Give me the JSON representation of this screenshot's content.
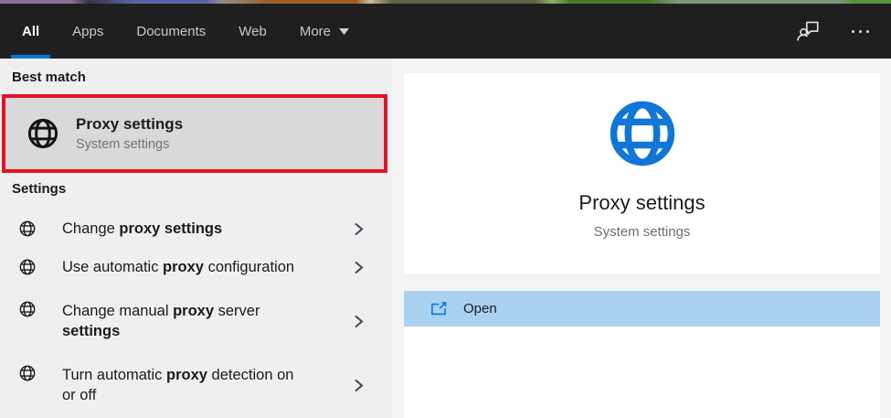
{
  "topbar": {
    "tabs": [
      {
        "label": "All",
        "active": true
      },
      {
        "label": "Apps",
        "active": false
      },
      {
        "label": "Documents",
        "active": false
      },
      {
        "label": "Web",
        "active": false
      },
      {
        "label": "More",
        "active": false,
        "dropdown": true
      }
    ]
  },
  "left_panel": {
    "best_match_header": "Best match",
    "best_match": {
      "title": "Proxy settings",
      "subtitle": "System settings",
      "icon": "globe-icon"
    },
    "settings_header": "Settings",
    "items": [
      {
        "icon": "globe-icon",
        "segments": [
          {
            "text": "Change ",
            "bold": false
          },
          {
            "text": "proxy settings",
            "bold": true
          }
        ]
      },
      {
        "icon": "globe-icon",
        "segments": [
          {
            "text": "Use automatic ",
            "bold": false
          },
          {
            "text": "proxy",
            "bold": true
          },
          {
            "text": " configuration",
            "bold": false
          }
        ]
      },
      {
        "icon": "globe-icon",
        "segments": [
          {
            "text": "Change manual ",
            "bold": false
          },
          {
            "text": "proxy",
            "bold": true
          },
          {
            "text": " server",
            "bold": false
          },
          {
            "text": "settings",
            "bold": true,
            "break_before": true
          }
        ]
      },
      {
        "icon": "globe-icon",
        "segments": [
          {
            "text": "Turn automatic ",
            "bold": false
          },
          {
            "text": "proxy",
            "bold": true
          },
          {
            "text": " detection on",
            "bold": false
          },
          {
            "text": "or off",
            "bold": false,
            "break_before": true
          }
        ]
      }
    ]
  },
  "right_panel": {
    "title": "Proxy settings",
    "subtitle": "System settings",
    "icon": "globe-icon",
    "open_label": "Open"
  },
  "colors": {
    "accent_blue": "#0078d7",
    "globe_blue": "#1176d5",
    "open_row_bg": "#a9d2f1",
    "annotation_red": "#e31226",
    "best_match_bg": "#d9d9d9",
    "topbar_bg": "#1f1f1f"
  },
  "wallpaper_gradient": [
    "#8a6f96 0%",
    "#8a6f96 8%",
    "#3a3440 10%",
    "#5a63a5 15%",
    "#5a63a5 23%",
    "#8d8d8d 25%",
    "#9c5f2a 30%",
    "#9c5f2a 40%",
    "#c9bb97 41.5%",
    "#5d6647 44%",
    "#5d6647 60%",
    "#90ad6b 62%",
    "#4d7a30 64%",
    "#4d7a30 73%",
    "#80967c 76%",
    "#80967c 94%",
    "#55933a 96%",
    "#55933a 100%"
  ]
}
